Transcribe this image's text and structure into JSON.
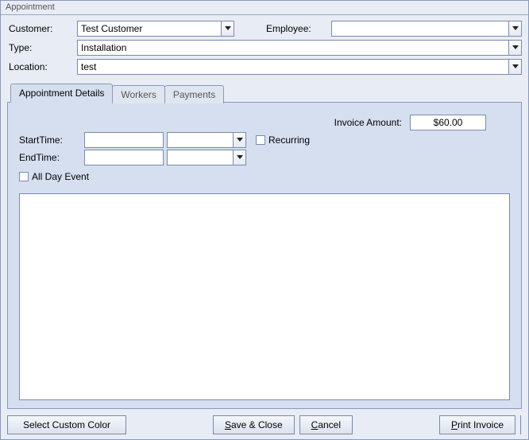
{
  "window": {
    "title": "Appointment"
  },
  "header": {
    "customer_label": "Customer:",
    "customer_value": "Test Customer",
    "employee_label": "Employee:",
    "employee_value": "",
    "type_label": "Type:",
    "type_value": "Installation",
    "location_label": "Location:",
    "location_value": "test"
  },
  "tabs": {
    "details": "Appointment Details",
    "workers": "Workers",
    "payments": "Payments"
  },
  "details": {
    "invoice_amount_label": "Invoice Amount:",
    "invoice_amount_value": "$60.00",
    "start_label": "StartTime:",
    "start_date": "",
    "start_time": "",
    "end_label": "EndTime:",
    "end_date": "",
    "end_time": "",
    "recurring_label": "Recurring",
    "all_day_label": "All Day Event",
    "notes": ""
  },
  "footer": {
    "select_color": "Select Custom Color",
    "save_prefix": "S",
    "save_suffix": "ave & Close",
    "cancel_prefix": "C",
    "cancel_suffix": "ancel",
    "print_prefix": "P",
    "print_suffix": "rint Invoice"
  }
}
